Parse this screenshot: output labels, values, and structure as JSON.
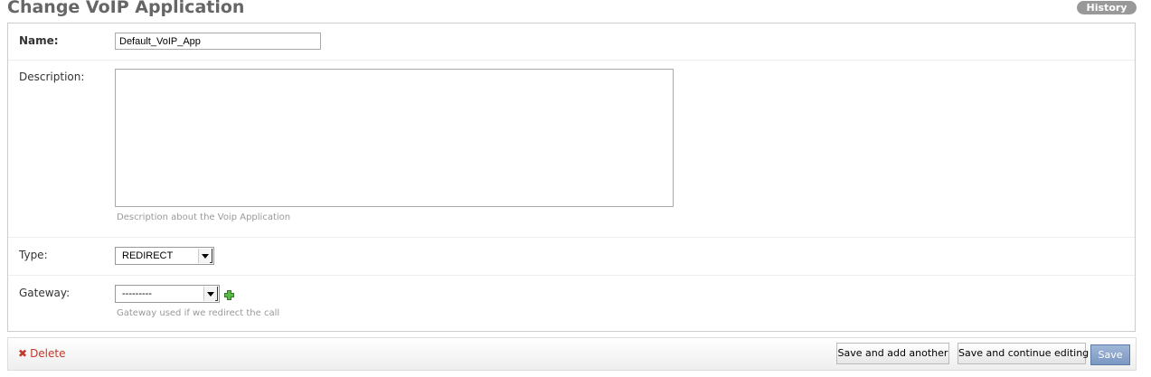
{
  "header": {
    "title": "Change VoIP Application",
    "history_label": "History"
  },
  "form": {
    "name": {
      "label": "Name:",
      "value": "Default_VoIP_App"
    },
    "description": {
      "label": "Description:",
      "value": "",
      "help": "Description about the Voip Application"
    },
    "type": {
      "label": "Type:",
      "selected": "REDIRECT"
    },
    "gateway": {
      "label": "Gateway:",
      "selected": "---------",
      "help": "Gateway used if we redirect the call",
      "add_icon": "plus-icon"
    }
  },
  "actions": {
    "delete_label": "Delete",
    "delete_icon": "✖",
    "save_add_another_label": "Save and add another",
    "save_continue_label": "Save and continue editing",
    "save_label": "Save"
  },
  "colors": {
    "title": "#666666",
    "history_bg": "#999999",
    "delete": "#c0392b",
    "save_button": "#7b98c2",
    "add_icon": "#3a9a2a"
  }
}
